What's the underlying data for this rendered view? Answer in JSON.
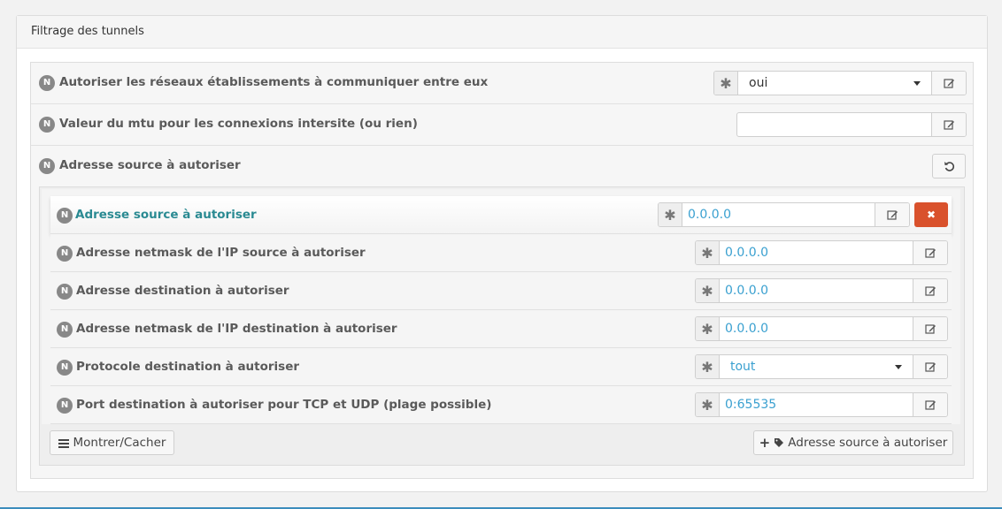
{
  "panel": {
    "title": "Filtrage des tunnels"
  },
  "badge": "N",
  "rows": {
    "autoriser_reseaux": {
      "label": "Autoriser les réseaux établissements à communiquer entre eux",
      "value": "oui"
    },
    "mtu": {
      "label": "Valeur du mtu pour les connexions intersite (ou rien)",
      "value": ""
    },
    "adresse_source_group": {
      "label": "Adresse source à autoriser"
    }
  },
  "inner_rows": [
    {
      "label": "Adresse source à autoriser",
      "value": "0.0.0.0"
    },
    {
      "label": "Adresse netmask de l'IP source à autoriser",
      "value": "0.0.0.0"
    },
    {
      "label": "Adresse destination à autoriser",
      "value": "0.0.0.0"
    },
    {
      "label": "Adresse netmask de l'IP destination à autoriser",
      "value": "0.0.0.0"
    },
    {
      "label": "Protocole destination à autoriser",
      "value": "tout"
    },
    {
      "label": "Port destination à autoriser pour TCP et UDP (plage possible)",
      "value": "0:65535"
    }
  ],
  "buttons": {
    "show_hide": "Montrer/Cacher",
    "add_source": "Adresse source à autoriser"
  },
  "icons": {
    "required": "asterisk-icon",
    "edit": "edit-icon",
    "undo": "undo-icon",
    "delete": "close-icon",
    "list": "list-icon",
    "plus": "plus-icon",
    "tag": "tag-icon"
  },
  "colors": {
    "accent_teal": "#2a8a92",
    "value_blue": "#3aa0d0",
    "delete_red": "#d9512c",
    "badge_gray": "#888888"
  }
}
